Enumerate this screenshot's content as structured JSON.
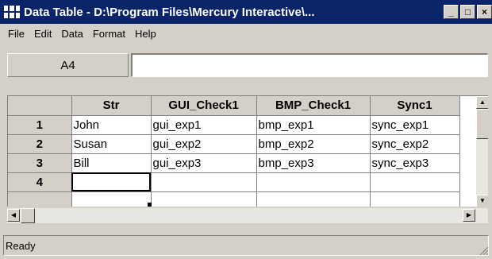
{
  "window": {
    "title": "Data Table - D:\\Program Files\\Mercury Interactive\\...",
    "icon": "table-grid-icon",
    "buttons": {
      "minimize": "_",
      "maximize": "□",
      "close": "×"
    },
    "title_bg": "#0a246a"
  },
  "menu": [
    {
      "label": "File"
    },
    {
      "label": "Edit"
    },
    {
      "label": "Data"
    },
    {
      "label": "Format"
    },
    {
      "label": "Help"
    }
  ],
  "cell_reference": "A4",
  "formula_value": "",
  "grid": {
    "columns": [
      "",
      "Str",
      "GUI_Check1",
      "BMP_Check1",
      "Sync1"
    ],
    "rows": [
      {
        "header": "1",
        "cells": [
          "John",
          "gui_exp1",
          "bmp_exp1",
          "sync_exp1"
        ]
      },
      {
        "header": "2",
        "cells": [
          "Susan",
          "gui_exp2",
          "bmp_exp2",
          "sync_exp2"
        ]
      },
      {
        "header": "3",
        "cells": [
          "Bill",
          "gui_exp3",
          "bmp_exp3",
          "sync_exp3"
        ]
      },
      {
        "header": "4",
        "cells": [
          "",
          "",
          "",
          ""
        ]
      }
    ],
    "active_cell": "A4"
  },
  "status": {
    "text": "Ready"
  }
}
